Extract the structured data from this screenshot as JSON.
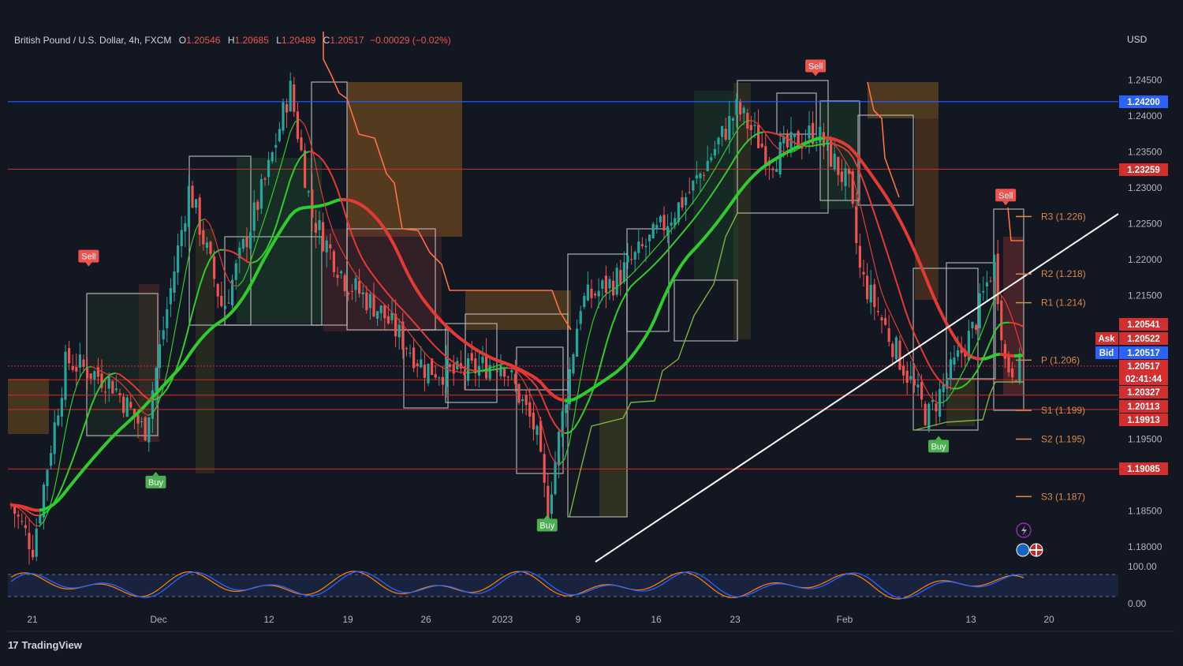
{
  "header": {
    "symbol": "British Pound / U.S. Dollar, 4h, FXCM",
    "open_label": "O",
    "open": "1.20546",
    "high_label": "H",
    "high": "1.20685",
    "low_label": "L",
    "low": "1.20489",
    "close_label": "C",
    "close": "1.20517",
    "change": "−0.00029 (−0.02%)"
  },
  "currency": "USD",
  "branding": {
    "logo_text": "TradingView",
    "logo_mark": "17"
  },
  "colors": {
    "background": "#131722",
    "bull": "#26a69a",
    "bear": "#ef5350",
    "ma_green": "#2ecc2e",
    "ma_red": "#e53935",
    "trailing": "#ff7043",
    "hline_red": "#d32f2f",
    "hline_blue": "#2962ff",
    "pivot": "#d9894a"
  },
  "price_axis": {
    "ticks": [
      "1.24500",
      "1.24000",
      "1.23500",
      "1.23000",
      "1.22500",
      "1.22000",
      "1.21500",
      "1.19500",
      "1.18500",
      "1.18000"
    ]
  },
  "time_axis": {
    "labels": [
      "21",
      "Dec",
      "12",
      "19",
      "26",
      "2023",
      "9",
      "16",
      "23",
      "Feb",
      "13",
      "20"
    ]
  },
  "price_tags": [
    {
      "text": "1.24200",
      "color": "#2962ff"
    },
    {
      "text": "1.23259",
      "color": "#d32f2f"
    },
    {
      "text": "1.20541",
      "color": "#d32f2f"
    },
    {
      "text": "1.20522",
      "color": "#d32f2f",
      "prefix": "Ask"
    },
    {
      "text": "1.20517",
      "color": "#2962ff",
      "prefix": "Bid"
    },
    {
      "text": "1.20517",
      "color": "#d32f2f",
      "sub": "02:41:44"
    },
    {
      "text": "1.20327",
      "color": "#d32f2f"
    },
    {
      "text": "1.20113",
      "color": "#d32f2f"
    },
    {
      "text": "1.19913",
      "color": "#d32f2f"
    },
    {
      "text": "1.19085",
      "color": "#d32f2f"
    }
  ],
  "pivots": [
    {
      "label": "R3 (1.226)",
      "value": 1.226
    },
    {
      "label": "R2 (1.218)",
      "value": 1.218
    },
    {
      "label": "R1 (1.214)",
      "value": 1.214
    },
    {
      "label": "P (1.206)",
      "value": 1.206
    },
    {
      "label": "S1 (1.199)",
      "value": 1.199
    },
    {
      "label": "S2 (1.195)",
      "value": 1.195
    },
    {
      "label": "S3 (1.187)",
      "value": 1.187
    }
  ],
  "signals": [
    {
      "type": "Sell",
      "date": "Nov 26",
      "price": 1.2185
    },
    {
      "type": "Buy",
      "date": "Dec 2",
      "price": 1.191
    },
    {
      "type": "Buy",
      "date": "Jan 6",
      "price": 1.185
    },
    {
      "type": "Sell",
      "date": "Jan 30",
      "price": 1.245
    },
    {
      "type": "Buy",
      "date": "Feb 10",
      "price": 1.196
    },
    {
      "type": "Sell",
      "date": "Feb 16",
      "price": 1.227
    }
  ],
  "oscillator": {
    "top": "100.00",
    "bottom": "0.00"
  },
  "chart_data": {
    "type": "line",
    "title": "British Pound / U.S. Dollar, 4h, FXCM",
    "xlabel": "",
    "ylabel": "",
    "x": [
      "Nov 18",
      "Nov 21",
      "Nov 24",
      "Nov 28",
      "Dec 1",
      "Dec 5",
      "Dec 8",
      "Dec 12",
      "Dec 14",
      "Dec 16",
      "Dec 19",
      "Dec 22",
      "Dec 26",
      "Dec 29",
      "Jan 2",
      "Jan 5",
      "Jan 6",
      "Jan 9",
      "Jan 12",
      "Jan 16",
      "Jan 19",
      "Jan 23",
      "Jan 26",
      "Jan 30",
      "Feb 2",
      "Feb 3",
      "Feb 6",
      "Feb 9",
      "Feb 13",
      "Feb 15",
      "Feb 16",
      "Feb 17"
    ],
    "series": [
      {
        "values": [
          1.189,
          1.18,
          1.206,
          1.203,
          1.196,
          1.23,
          1.213,
          1.232,
          1.244,
          1.226,
          1.217,
          1.213,
          1.205,
          1.204,
          1.206,
          1.196,
          1.185,
          1.214,
          1.217,
          1.224,
          1.23,
          1.241,
          1.234,
          1.238,
          1.23,
          1.218,
          1.208,
          1.198,
          1.21,
          1.22,
          1.205,
          1.205
        ]
      }
    ],
    "ylim": [
      1.175,
      1.252
    ],
    "xlim": [
      "Nov 18",
      "Feb 24"
    ],
    "horizontal_lines": [
      1.242,
      1.23259,
      1.20517,
      1.20327,
      1.20113,
      1.19913,
      1.19085
    ],
    "grid": false,
    "legend": "none"
  }
}
